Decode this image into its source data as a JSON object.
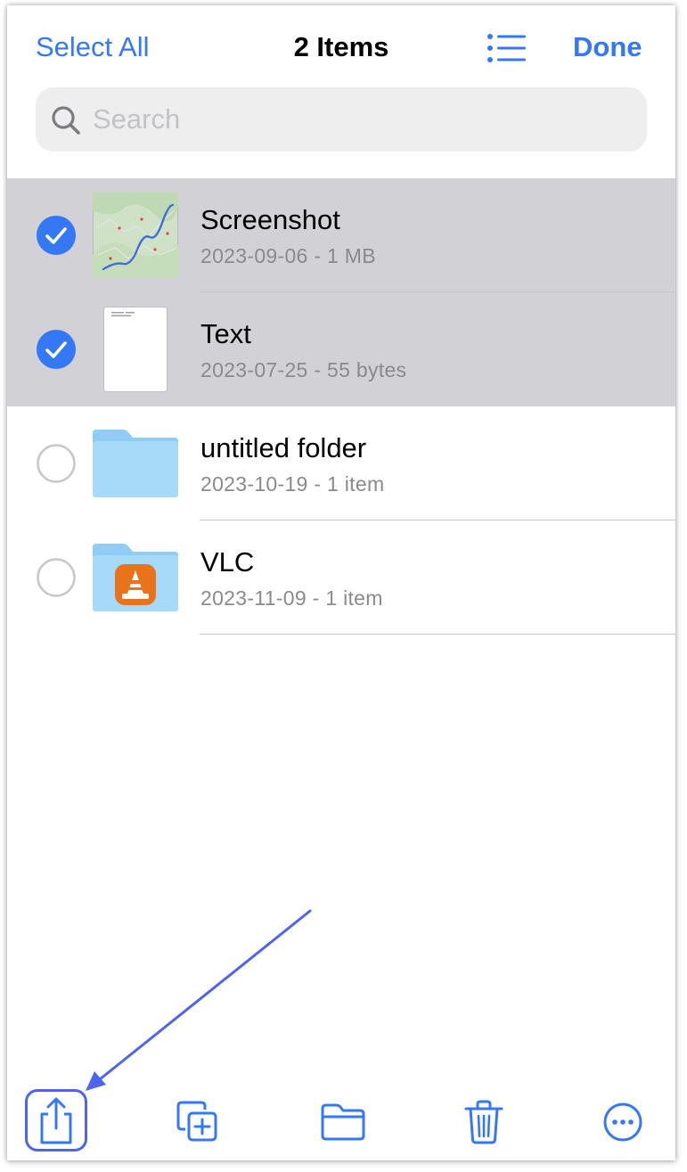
{
  "header": {
    "select_all": "Select All",
    "title": "2 Items",
    "done": "Done",
    "list_view_icon": "list-bullet-icon"
  },
  "search": {
    "placeholder": "Search",
    "value": "",
    "icon": "search-icon"
  },
  "files": [
    {
      "name": "Screenshot",
      "meta": "2023-09-06 - 1 MB",
      "selected": true,
      "thumbnail": "map-screenshot-thumbnail"
    },
    {
      "name": "Text",
      "meta": "2023-07-25 - 55 bytes",
      "selected": true,
      "thumbnail": "text-document-thumbnail"
    },
    {
      "name": "untitled folder",
      "meta": "2023-10-19 - 1 item",
      "selected": false,
      "thumbnail": "folder-icon"
    },
    {
      "name": "VLC",
      "meta": "2023-11-09 - 1 item",
      "selected": false,
      "thumbnail": "vlc-folder-icon"
    }
  ],
  "toolbar": {
    "items": [
      "share-icon",
      "duplicate-icon",
      "move-folder-icon",
      "trash-icon",
      "more-icon"
    ]
  },
  "colors": {
    "accent": "#3478f6",
    "selected_row": "#d1d1d6",
    "subtitle": "#8a8a8e",
    "search_bg": "#eeeeef",
    "annotation": "#4f64ec",
    "folder": "#8fcdf5",
    "vlc_orange": "#e8731a"
  }
}
